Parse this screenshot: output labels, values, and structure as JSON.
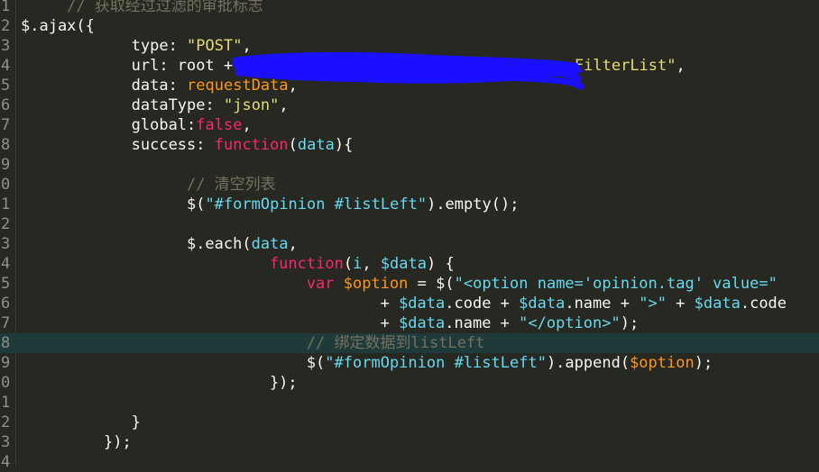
{
  "editor": {
    "theme_colors": {
      "background": "#272822",
      "current_line": "#1f3a3a",
      "redaction": "#1a10ff"
    },
    "lines": [
      {
        "number": "1",
        "indent": 5,
        "tokens": [
          {
            "type": "comment",
            "text": "// 获取经过过滤的审批标志"
          }
        ]
      },
      {
        "number": "2",
        "indent": 0,
        "tokens": [
          {
            "type": "default",
            "text": "$.ajax({"
          }
        ]
      },
      {
        "number": "3",
        "indent": 12,
        "tokens": [
          {
            "type": "default",
            "text": "type: "
          },
          {
            "type": "string",
            "text": "\"POST\""
          },
          {
            "type": "default",
            "text": ","
          }
        ]
      },
      {
        "number": "4",
        "indent": 12,
        "tokens": [
          {
            "type": "default",
            "text": "url: root + "
          },
          {
            "type": "string",
            "text": "\"/                                  FilterList\""
          },
          {
            "type": "default",
            "text": ","
          }
        ]
      },
      {
        "number": "5",
        "indent": 12,
        "tokens": [
          {
            "type": "default",
            "text": "data: "
          },
          {
            "type": "param",
            "text": "requestData"
          },
          {
            "type": "default",
            "text": ","
          }
        ]
      },
      {
        "number": "6",
        "indent": 12,
        "tokens": [
          {
            "type": "default",
            "text": "dataType: "
          },
          {
            "type": "string",
            "text": "\"json\""
          },
          {
            "type": "default",
            "text": ","
          }
        ]
      },
      {
        "number": "7",
        "indent": 12,
        "tokens": [
          {
            "type": "default",
            "text": "global:"
          },
          {
            "type": "keyword",
            "text": "false"
          },
          {
            "type": "default",
            "text": ","
          }
        ]
      },
      {
        "number": "8",
        "indent": 12,
        "tokens": [
          {
            "type": "default",
            "text": "success: "
          },
          {
            "type": "keyword",
            "text": "function"
          },
          {
            "type": "default",
            "text": "("
          },
          {
            "type": "builtin",
            "text": "data"
          },
          {
            "type": "default",
            "text": "){"
          }
        ]
      },
      {
        "number": "9",
        "indent": 0,
        "tokens": []
      },
      {
        "number": "0",
        "indent": 18,
        "tokens": [
          {
            "type": "comment",
            "text": "// 清空列表"
          }
        ]
      },
      {
        "number": "1",
        "indent": 18,
        "tokens": [
          {
            "type": "default",
            "text": "$("
          },
          {
            "type": "strcode",
            "text": "\"#formOpinion #listLeft\""
          },
          {
            "type": "default",
            "text": ").empty();"
          }
        ]
      },
      {
        "number": "2",
        "indent": 0,
        "tokens": []
      },
      {
        "number": "3",
        "indent": 18,
        "tokens": [
          {
            "type": "default",
            "text": "$.each("
          },
          {
            "type": "builtin",
            "text": "data"
          },
          {
            "type": "default",
            "text": ","
          }
        ]
      },
      {
        "number": "4",
        "indent": 27,
        "tokens": [
          {
            "type": "keyword",
            "text": "function"
          },
          {
            "type": "default",
            "text": "("
          },
          {
            "type": "builtin",
            "text": "i"
          },
          {
            "type": "default",
            "text": ", "
          },
          {
            "type": "builtin",
            "text": "$data"
          },
          {
            "type": "default",
            "text": ") {"
          }
        ]
      },
      {
        "number": "5",
        "indent": 31,
        "tokens": [
          {
            "type": "keyword",
            "text": "var "
          },
          {
            "type": "param",
            "text": "$option"
          },
          {
            "type": "default",
            "text": " = $("
          },
          {
            "type": "strcode",
            "text": "\"<option name='opinion.tag' value=\""
          }
        ]
      },
      {
        "number": "6",
        "indent": 39,
        "tokens": [
          {
            "type": "default",
            "text": "+ "
          },
          {
            "type": "builtin",
            "text": "$data"
          },
          {
            "type": "default",
            "text": ".code + "
          },
          {
            "type": "builtin",
            "text": "$data"
          },
          {
            "type": "default",
            "text": ".name + "
          },
          {
            "type": "strcode",
            "text": "\">\""
          },
          {
            "type": "default",
            "text": " + "
          },
          {
            "type": "builtin",
            "text": "$data"
          },
          {
            "type": "default",
            "text": ".code"
          }
        ]
      },
      {
        "number": "7",
        "indent": 39,
        "tokens": [
          {
            "type": "default",
            "text": "+ "
          },
          {
            "type": "builtin",
            "text": "$data"
          },
          {
            "type": "default",
            "text": ".name + "
          },
          {
            "type": "strcode",
            "text": "\"</option>\""
          },
          {
            "type": "default",
            "text": ");"
          }
        ]
      },
      {
        "number": "8",
        "indent": 31,
        "current": true,
        "tokens": [
          {
            "type": "comment",
            "text": "// 绑定数据到listLeft"
          }
        ]
      },
      {
        "number": "9",
        "indent": 31,
        "tokens": [
          {
            "type": "default",
            "text": "$("
          },
          {
            "type": "strcode",
            "text": "\"#formOpinion #listLeft\""
          },
          {
            "type": "default",
            "text": ").append("
          },
          {
            "type": "param",
            "text": "$option"
          },
          {
            "type": "default",
            "text": ");"
          }
        ]
      },
      {
        "number": "0",
        "indent": 27,
        "tokens": [
          {
            "type": "default",
            "text": "});"
          }
        ]
      },
      {
        "number": "1",
        "indent": 0,
        "tokens": []
      },
      {
        "number": "2",
        "indent": 12,
        "tokens": [
          {
            "type": "default",
            "text": "}"
          }
        ]
      },
      {
        "number": "3",
        "indent": 9,
        "tokens": [
          {
            "type": "default",
            "text": "});"
          }
        ]
      },
      {
        "number": "4",
        "indent": 0,
        "tokens": []
      }
    ]
  }
}
